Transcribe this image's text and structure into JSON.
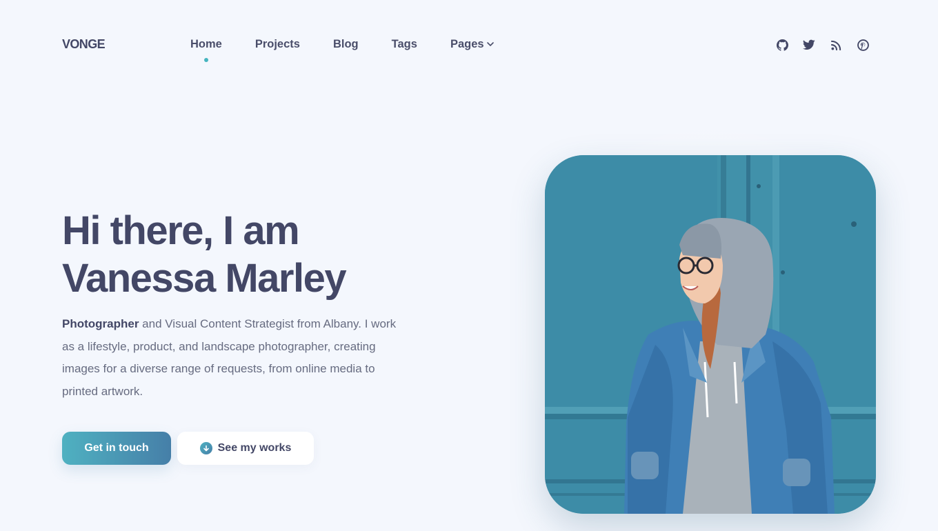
{
  "brand": {
    "logo": "VONGE"
  },
  "nav": {
    "items": [
      {
        "label": "Home",
        "active": true
      },
      {
        "label": "Projects"
      },
      {
        "label": "Blog"
      },
      {
        "label": "Tags"
      },
      {
        "label": "Pages",
        "has_dropdown": true
      }
    ]
  },
  "social": [
    "github-icon",
    "twitter-icon",
    "rss-icon",
    "pinterest-icon"
  ],
  "hero": {
    "title_line1": "Hi there, I am",
    "title_line2": "Vanessa Marley",
    "desc_strong": "Photographer",
    "desc_rest": " and Visual Content Strategist from Albany. I work as a lifestyle, product, and landscape photographer, creating images for a diverse range of requests, from online media to printed artwork.",
    "cta_primary": "Get in touch",
    "cta_secondary": "See my works",
    "photo_alt": "Vanessa Marley"
  },
  "colors": {
    "background": "#f4f7fd",
    "heading": "#434766",
    "accent": "#45b4bf",
    "accent_dark": "#467fa8"
  }
}
